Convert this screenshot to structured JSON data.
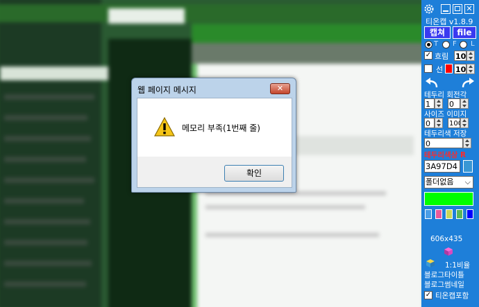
{
  "dialog": {
    "title": "웹 페이지 메시지",
    "message": "메모리 부족(1번째 줄)",
    "ok_label": "확인",
    "close_label": "✕"
  },
  "panel": {
    "title": "티온캡 v1.8.9",
    "capture_label": "캡쳐",
    "file_label": "file",
    "radio_labels": [
      "T",
      "F",
      "L"
    ],
    "blur": {
      "label": "흐림",
      "value": "10",
      "checked": true
    },
    "line": {
      "label": "선",
      "value": "10",
      "checked": false,
      "color": "#ff0000"
    },
    "border_rotate_label": "테두리 회전각",
    "border_value": "1",
    "rotate_value": "0",
    "size_image_label": "사이즈 이미지",
    "size_value": "0",
    "image_value": "100",
    "border_color_save_label": "테두리색 저장",
    "save_value": "0",
    "border_color_label": "테두리색상 R",
    "color_hex": "3A97D4",
    "folder_select": "폴더없음",
    "green_swatch": "#00ff00",
    "palette": [
      "#4a9ee6",
      "#e85a9b",
      "#c8d85a",
      "#5ab85a",
      "#0000ff"
    ],
    "dimensions": "606x435",
    "ratio_label": "1:1비율",
    "blog_title_label": "블로그타이틀",
    "blog_thumb_label": "블로그썸네일",
    "include_label": "티온캡포함",
    "include_checked": true
  },
  "colors": {
    "panel_bg": "#1e7fd9",
    "accent_green": "#00ff00",
    "dialog_frame": "#bcd3ea"
  }
}
